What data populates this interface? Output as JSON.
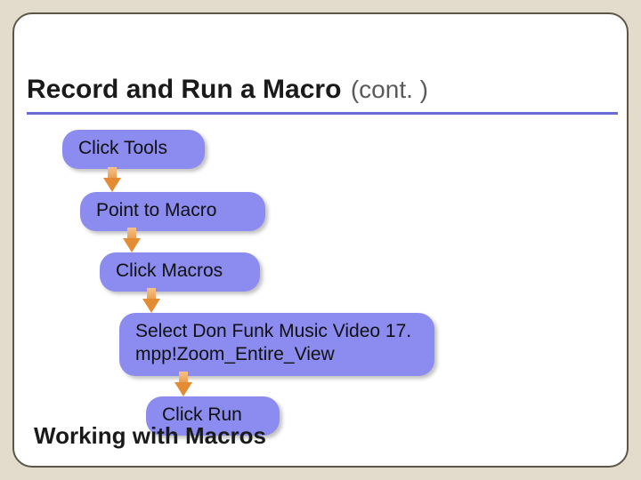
{
  "title": {
    "main": "Record and Run a Macro",
    "cont": "(cont. )"
  },
  "steps": [
    {
      "label": "Click Tools"
    },
    {
      "label": "Point to Macro"
    },
    {
      "label": "Click Macros"
    },
    {
      "label": "Select Don Funk Music Video 17. mpp!Zoom_Entire_View"
    },
    {
      "label": "Click Run"
    }
  ],
  "footer": "Working with Macros"
}
